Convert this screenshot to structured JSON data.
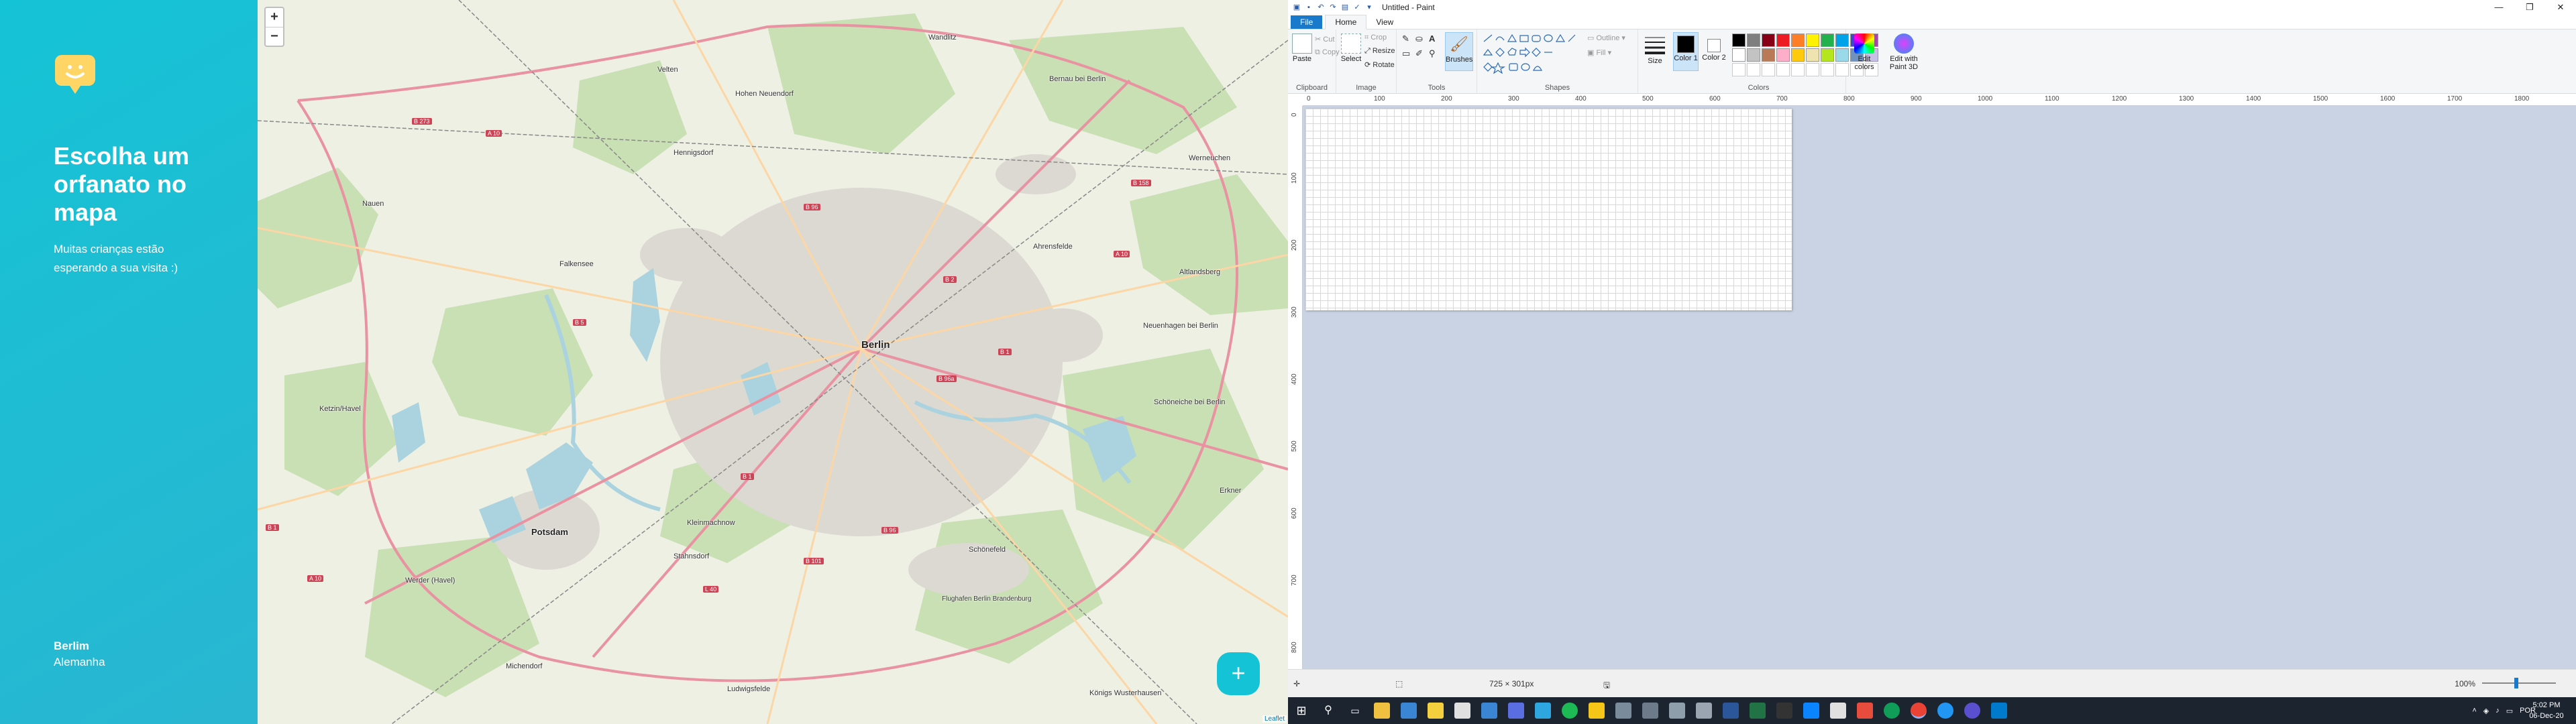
{
  "happy": {
    "title": "Escolha um orfanato no mapa",
    "description": "Muitas crianças estão esperando a sua visita :)",
    "city": "Berlim",
    "country": "Alemanha",
    "brand_color": "#15c3d6",
    "logo_icon": "smile-marker-icon"
  },
  "map": {
    "zoom_in": "+",
    "zoom_out": "−",
    "add_button": "+",
    "attribution": "Leaflet",
    "labels": {
      "berlin": "Berlin",
      "potsdam": "Potsdam",
      "velten": "Velten",
      "hohen_neuendorf": "Hohen Neuendorf",
      "bernau": "Bernau bei Berlin",
      "werneuchen": "Werneuchen",
      "ahrensfelde": "Ahrensfelde",
      "altlandsberg": "Altlandsberg",
      "neuenhagen": "Neuenhagen bei Berlin",
      "schoeneiche": "Schöneiche bei Berlin",
      "erkner": "Erkner",
      "schoenefeld": "Schönefeld",
      "kleinmachnow": "Kleinmachnow",
      "stahnsdorf": "Stahnsdorf",
      "werder": "Werder (Havel)",
      "michendorf": "Michendorf",
      "ludwigsfelde": "Ludwigsfelde",
      "koenigs_wusterhausen": "Königs Wusterhausen",
      "falkensee": "Falkensee",
      "nauen": "Nauen",
      "ketzin": "Ketzin/Havel",
      "hennigsdorf": "Hennigsdorf",
      "wandlitz": "Wandlitz",
      "flughafen": "Flughafen Berlin Brandenburg"
    },
    "roads": [
      "B 273",
      "A 10",
      "B 96",
      "B 158",
      "A 10",
      "B 2",
      "B 5",
      "B 1",
      "B 96a",
      "B 1",
      "B 96",
      "B 101",
      "L 40",
      "A 10",
      "B 1"
    ]
  },
  "paint": {
    "title": "Untitled - Paint",
    "tabs": {
      "file": "File",
      "home": "Home",
      "view": "View"
    },
    "clipboard": {
      "paste": "Paste",
      "cut": "Cut",
      "copy": "Copy",
      "label": "Clipboard"
    },
    "image": {
      "select": "Select",
      "crop": "Crop",
      "resize": "Resize",
      "rotate": "Rotate",
      "label": "Image"
    },
    "tools": {
      "label": "Tools",
      "brushes": "Brushes"
    },
    "shapes": {
      "outline": "Outline",
      "fill": "Fill",
      "label": "Shapes"
    },
    "size": "Size",
    "color1": "Color 1",
    "color2": "Color 2",
    "colors_label": "Colors",
    "edit_colors": "Edit colors",
    "edit_3d": "Edit with Paint 3D",
    "palette": [
      "#000000",
      "#7f7f7f",
      "#880015",
      "#ed1c24",
      "#ff7f27",
      "#fff200",
      "#22b14c",
      "#00a2e8",
      "#3f48cc",
      "#a349a4",
      "#ffffff",
      "#c3c3c3",
      "#b97a57",
      "#ffaec9",
      "#ffc90e",
      "#efe4b0",
      "#b5e61d",
      "#99d9ea",
      "#7092be",
      "#c8bfe7"
    ],
    "ruler_h": [
      "0",
      "100",
      "200",
      "300",
      "400",
      "500",
      "600",
      "700",
      "800",
      "900",
      "1000",
      "1100",
      "1200",
      "1300",
      "1400",
      "1500",
      "1600",
      "1700",
      "1800"
    ],
    "ruler_v": [
      "0",
      "100",
      "200",
      "300",
      "400",
      "500",
      "600",
      "700",
      "800"
    ],
    "status": {
      "dimensions": "725 × 301px",
      "zoom": "100%"
    }
  },
  "taskbar": {
    "language": "POR",
    "time": "5:02 PM",
    "date": "06-Dec-20"
  }
}
